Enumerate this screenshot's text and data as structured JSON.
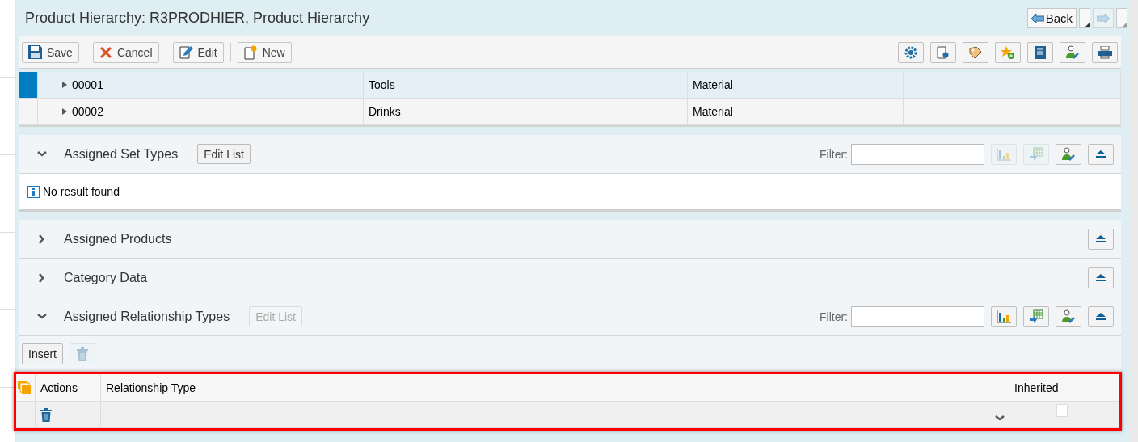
{
  "title": "Product Hierarchy: R3PRODHIER, Product Hierarchy",
  "navigation": {
    "back": "Back",
    "forward_disabled": true
  },
  "toolbar": [
    {
      "kind": "save",
      "label": "Save"
    },
    {
      "kind": "cancel",
      "label": "Cancel"
    },
    {
      "kind": "edit",
      "label": "Edit"
    },
    {
      "kind": "new",
      "label": "New"
    }
  ],
  "toolbar_tools": [
    {
      "kind": "settings"
    },
    {
      "kind": "page-settings"
    },
    {
      "kind": "tag"
    },
    {
      "kind": "favorite"
    },
    {
      "kind": "notes"
    },
    {
      "kind": "personalize"
    },
    {
      "kind": "print"
    }
  ],
  "hierarchy_rows": [
    {
      "selected": true,
      "cells": [
        "00001",
        "Tools",
        "Material"
      ]
    },
    {
      "selected": false,
      "cells": [
        "00002",
        "Drinks",
        "Material"
      ]
    }
  ],
  "sections": [
    {
      "title": "Assigned Set Types",
      "expanded": true,
      "edit_list": {
        "label": "Edit List",
        "disabled": false
      },
      "filter_label": "Filter:",
      "tools": [
        {
          "kind": "chart",
          "disabled": true
        },
        {
          "kind": "export",
          "disabled": true
        },
        {
          "kind": "personalize",
          "disabled": false
        }
      ],
      "message": "No result found"
    },
    {
      "title": "Assigned Products",
      "expanded": false
    },
    {
      "title": "Category Data",
      "expanded": false
    },
    {
      "title": "Assigned Relationship Types",
      "expanded": true,
      "edit_list": {
        "label": "Edit List",
        "disabled": true
      },
      "filter_label": "Filter:",
      "tools": [
        {
          "kind": "chart",
          "disabled": false
        },
        {
          "kind": "export",
          "disabled": false
        },
        {
          "kind": "personalize",
          "disabled": false
        }
      ],
      "actions": {
        "insert": "Insert",
        "delete_disabled": true
      },
      "table": {
        "columns": [
          "Actions",
          "Relationship Type",
          "Inherited"
        ],
        "rows": [
          {
            "inherited": false
          }
        ]
      }
    }
  ]
}
